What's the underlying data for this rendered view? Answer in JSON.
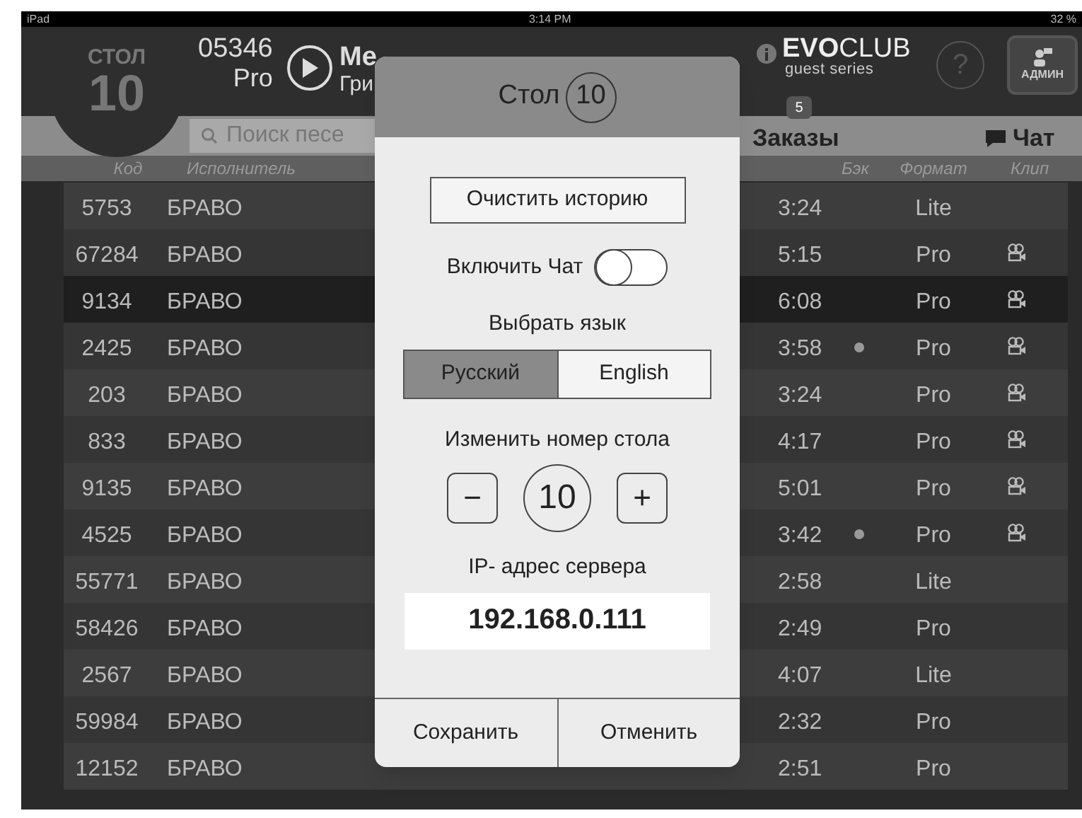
{
  "status_bar": {
    "device": "iPad",
    "time": "3:14 PM",
    "battery": "32 %"
  },
  "header": {
    "table_label": "СТОЛ",
    "table_number": "10",
    "song_code": "05346",
    "song_format": "Pro",
    "song_title": "Ме",
    "song_artist": "Гри",
    "brand_bold": "EVO",
    "brand_light": "CLUB",
    "brand_sub": "guest series",
    "help": "?",
    "admin": "АДМИН"
  },
  "toolbar": {
    "search": {
      "placeholder": "Поиск песе"
    },
    "orders": {
      "label": "Заказы",
      "badge": "5"
    },
    "chat": {
      "label": "Чат"
    }
  },
  "table": {
    "columns": [
      "Код",
      "Исполнитель",
      "Бэк",
      "Формат",
      "Клип"
    ],
    "rows": [
      {
        "code": "5753",
        "artist": "БРАВО",
        "duration": "3:24",
        "back": false,
        "format": "Lite",
        "clip": false,
        "selected": false
      },
      {
        "code": "67284",
        "artist": "БРАВО",
        "duration": "5:15",
        "back": false,
        "format": "Pro",
        "clip": true,
        "selected": false
      },
      {
        "code": "9134",
        "artist": "БРАВО",
        "duration": "6:08",
        "back": false,
        "format": "Pro",
        "clip": true,
        "selected": true
      },
      {
        "code": "2425",
        "artist": "БРАВО",
        "duration": "3:58",
        "back": true,
        "format": "Pro",
        "clip": true,
        "selected": false
      },
      {
        "code": "203",
        "artist": "БРАВО",
        "duration": "3:24",
        "back": false,
        "format": "Pro",
        "clip": true,
        "selected": false
      },
      {
        "code": "833",
        "artist": "БРАВО",
        "duration": "4:17",
        "back": false,
        "format": "Pro",
        "clip": true,
        "selected": false
      },
      {
        "code": "9135",
        "artist": "БРАВО",
        "duration": "5:01",
        "back": false,
        "format": "Pro",
        "clip": true,
        "selected": false
      },
      {
        "code": "4525",
        "artist": "БРАВО",
        "duration": "3:42",
        "back": true,
        "format": "Pro",
        "clip": true,
        "selected": false
      },
      {
        "code": "55771",
        "artist": "БРАВО",
        "duration": "2:58",
        "back": false,
        "format": "Lite",
        "clip": false,
        "selected": false
      },
      {
        "code": "58426",
        "artist": "БРАВО",
        "duration": "2:49",
        "back": false,
        "format": "Pro",
        "clip": false,
        "selected": false
      },
      {
        "code": "2567",
        "artist": "БРАВО",
        "duration": "4:07",
        "back": false,
        "format": "Lite",
        "clip": false,
        "selected": false
      },
      {
        "code": "59984",
        "artist": "БРАВО",
        "duration": "2:32",
        "back": false,
        "format": "Pro",
        "clip": false,
        "selected": false
      },
      {
        "code": "12152",
        "artist": "БРАВО",
        "duration": "2:51",
        "back": false,
        "format": "Pro",
        "clip": false,
        "selected": false
      }
    ]
  },
  "dialog": {
    "title": "Стол",
    "table_number": "10",
    "clear_button": "Очистить историю",
    "chat_label": "Включить Чат",
    "chat_on": false,
    "language_label": "Выбрать язык",
    "languages": [
      {
        "label": "Русский",
        "selected": true
      },
      {
        "label": "English",
        "selected": false
      }
    ],
    "number_label": "Изменить номер стола",
    "minus": "−",
    "number": "10",
    "plus": "+",
    "ip_label": "IP- адрес сервера",
    "ip_value": "192.168.0.111",
    "buttons": [
      "Сохранить",
      "Отменить"
    ]
  }
}
